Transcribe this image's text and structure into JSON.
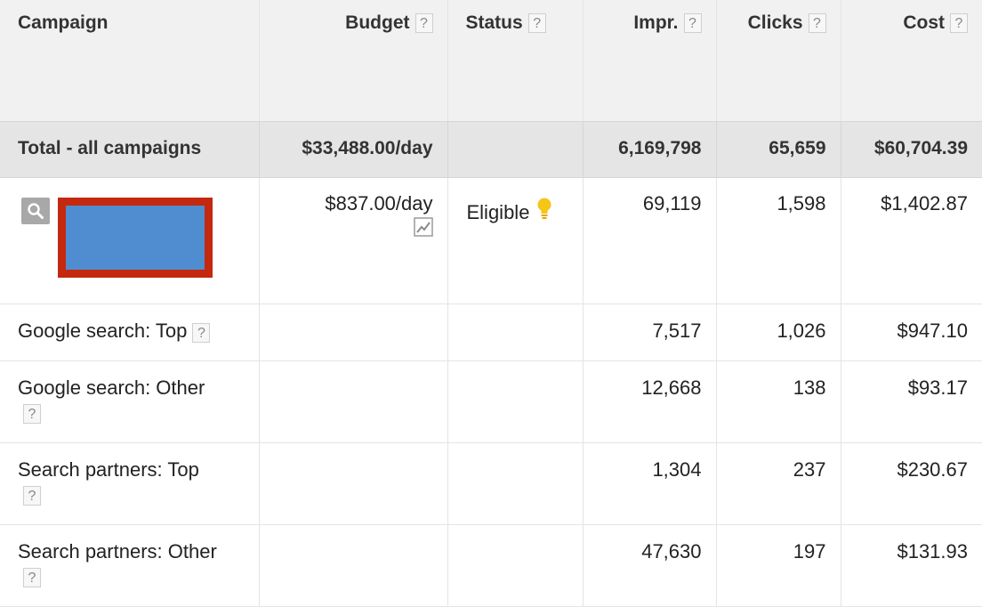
{
  "columns": {
    "campaign": "Campaign",
    "budget": "Budget",
    "status": "Status",
    "impr": "Impr.",
    "clicks": "Clicks",
    "cost": "Cost",
    "help": "?"
  },
  "total": {
    "label": "Total - all campaigns",
    "budget": "$33,488.00/day",
    "impr": "6,169,798",
    "clicks": "65,659",
    "cost": "$60,704.39"
  },
  "campaign_row": {
    "budget": "$837.00/day",
    "status": "Eligible",
    "impr": "69,119",
    "clicks": "1,598",
    "cost": "$1,402.87"
  },
  "segments": [
    {
      "label": "Google search: Top",
      "impr": "7,517",
      "clicks": "1,026",
      "cost": "$947.10"
    },
    {
      "label": "Google search: Other",
      "impr": "12,668",
      "clicks": "138",
      "cost": "$93.17"
    },
    {
      "label": "Search partners: Top",
      "impr": "1,304",
      "clicks": "237",
      "cost": "$230.67"
    },
    {
      "label": "Search partners: Other",
      "impr": "47,630",
      "clicks": "197",
      "cost": "$131.93"
    }
  ],
  "colors": {
    "header_bg": "#f1f1f1",
    "total_bg": "#e5e5e5",
    "redaction_border": "#c4280f",
    "redaction_fill": "#4f8dd0",
    "bulb": "#f5c518"
  },
  "icons": [
    "search-icon",
    "trend-chart-icon",
    "lightbulb-icon",
    "help-icon"
  ]
}
